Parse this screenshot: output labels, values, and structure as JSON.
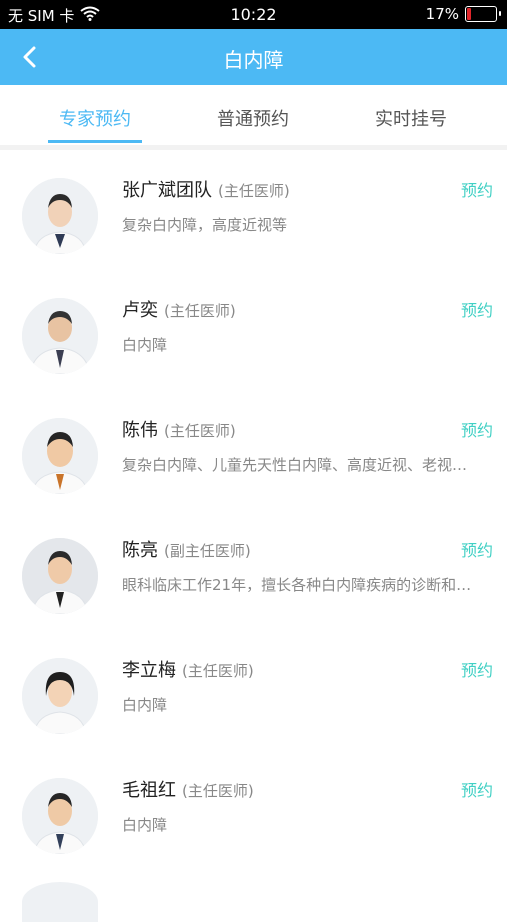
{
  "status_bar": {
    "carrier": "无 SIM 卡",
    "time": "10:22",
    "battery_percent": "17%"
  },
  "nav": {
    "title": "白内障"
  },
  "tabs": [
    {
      "label": "专家预约",
      "active": true
    },
    {
      "label": "普通预约",
      "active": false
    },
    {
      "label": "实时挂号",
      "active": false
    }
  ],
  "book_label": "预约",
  "doctors": [
    {
      "name": "张广斌团队",
      "title": "(主任医师)",
      "desc": "复杂白内障，高度近视等"
    },
    {
      "name": "卢奕",
      "title": "(主任医师)",
      "desc": "白内障"
    },
    {
      "name": "陈伟",
      "title": "(主任医师)",
      "desc": "复杂白内障、儿童先天性白内障、高度近视、老视…"
    },
    {
      "name": "陈亮",
      "title": "(副主任医师)",
      "desc": "眼科临床工作21年，擅长各种白内障疾病的诊断和…"
    },
    {
      "name": "李立梅",
      "title": "(主任医师)",
      "desc": "白内障"
    },
    {
      "name": "毛祖红",
      "title": "(主任医师)",
      "desc": "白内障"
    }
  ],
  "colors": {
    "primary": "#4cb9f4",
    "book": "#41d0c4"
  }
}
